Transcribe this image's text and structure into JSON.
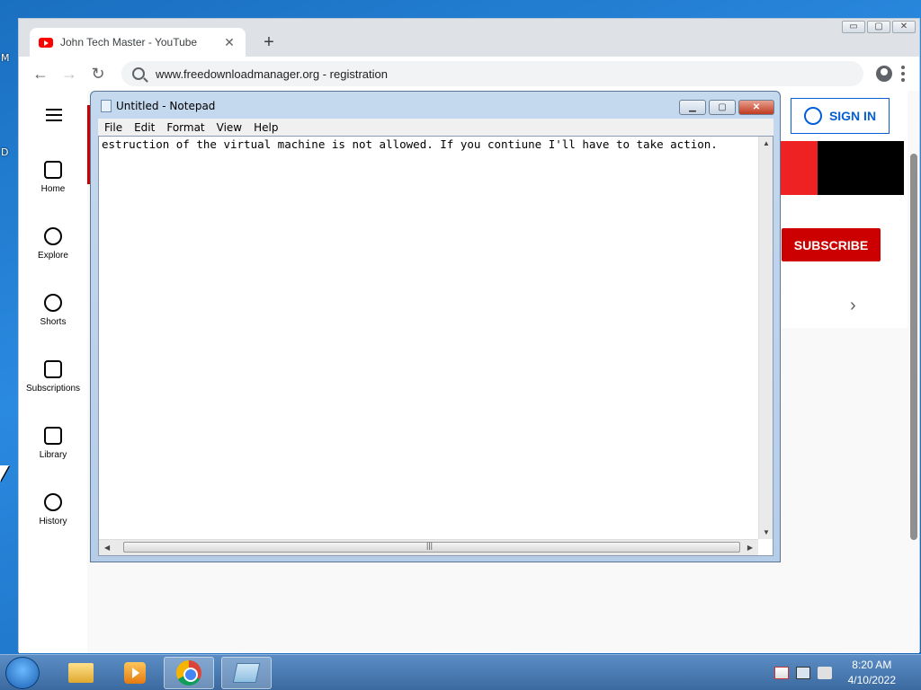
{
  "desktop": {
    "labels": [
      "M",
      "D"
    ]
  },
  "browser": {
    "tab_title": "John Tech Master - YouTube",
    "tab_close": "✕",
    "new_tab": "+",
    "address": "www.freedownloadmanager.org - registration",
    "back_glyph": "←",
    "forward_glyph": "→",
    "reload_glyph": "↻",
    "window_buttons": [
      "▭",
      "▢",
      "✕"
    ]
  },
  "youtube": {
    "sidebar": [
      {
        "label": "Home",
        "icon": "home-icon"
      },
      {
        "label": "Explore",
        "icon": "compass-icon"
      },
      {
        "label": "Shorts",
        "icon": "shorts-icon"
      },
      {
        "label": "Subscriptions",
        "icon": "subscriptions-icon"
      },
      {
        "label": "Library",
        "icon": "library-icon"
      },
      {
        "label": "History",
        "icon": "history-icon"
      }
    ],
    "sign_in": "SIGN IN",
    "subscribe": "SUBSCRIBE",
    "chevron": "›"
  },
  "notepad": {
    "title": "Untitled - Notepad",
    "menu": [
      "File",
      "Edit",
      "Format",
      "View",
      "Help"
    ],
    "content": "estruction of the virtual machine is not allowed. If you contiune I'll have to take action.",
    "buttons": {
      "minimize": "▁",
      "maximize": "▢",
      "close": "✕"
    },
    "scroll_left": "◀",
    "scroll_right": "▶",
    "scroll_up": "▲",
    "scroll_down": "▼",
    "hthumb_grip": "|||"
  },
  "taskbar": {
    "time": "8:20 AM",
    "date": "4/10/2022",
    "items": [
      "windows-explorer",
      "media-player",
      "google-chrome",
      "notepad"
    ]
  }
}
